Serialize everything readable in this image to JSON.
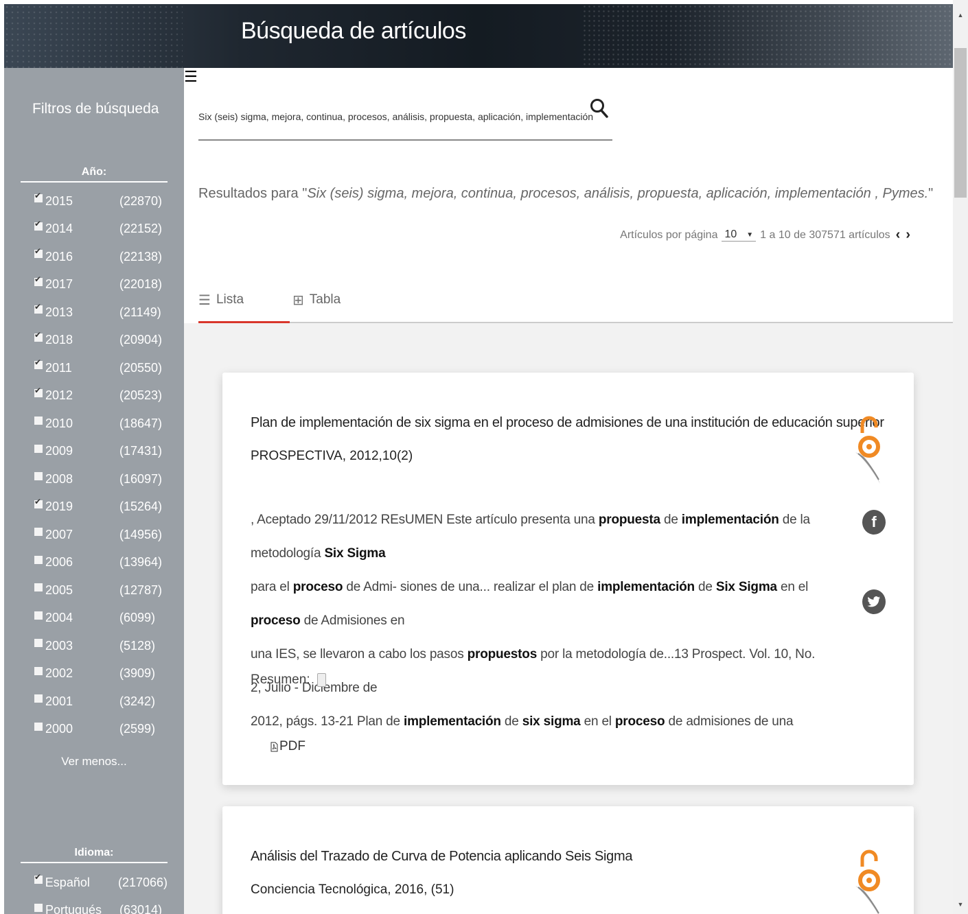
{
  "header": {
    "title": "Búsqueda de artículos"
  },
  "sidebar": {
    "filters_title": "Filtros de búsqueda",
    "year": {
      "title": "Año:",
      "items": [
        {
          "label": "2015",
          "count": "(22870)",
          "checked": true
        },
        {
          "label": "2014",
          "count": "(22152)",
          "checked": true
        },
        {
          "label": "2016",
          "count": "(22138)",
          "checked": true
        },
        {
          "label": "2017",
          "count": "(22018)",
          "checked": true
        },
        {
          "label": "2013",
          "count": "(21149)",
          "checked": true
        },
        {
          "label": "2018",
          "count": "(20904)",
          "checked": true
        },
        {
          "label": "2011",
          "count": "(20550)",
          "checked": true
        },
        {
          "label": "2012",
          "count": "(20523)",
          "checked": true
        },
        {
          "label": "2010",
          "count": "(18647)",
          "checked": false
        },
        {
          "label": "2009",
          "count": "(17431)",
          "checked": false
        },
        {
          "label": "2008",
          "count": "(16097)",
          "checked": false
        },
        {
          "label": "2019",
          "count": "(15264)",
          "checked": true
        },
        {
          "label": "2007",
          "count": "(14956)",
          "checked": false
        },
        {
          "label": "2006",
          "count": "(13964)",
          "checked": false
        },
        {
          "label": "2005",
          "count": "(12787)",
          "checked": false
        },
        {
          "label": "2004",
          "count": "(6099)",
          "checked": false
        },
        {
          "label": "2003",
          "count": "(5128)",
          "checked": false
        },
        {
          "label": "2002",
          "count": "(3909)",
          "checked": false
        },
        {
          "label": "2001",
          "count": "(3242)",
          "checked": false
        },
        {
          "label": "2000",
          "count": "(2599)",
          "checked": false
        }
      ],
      "more_link": "Ver menos..."
    },
    "language": {
      "title": "Idioma:",
      "items": [
        {
          "label": "Español",
          "count": "(217066)",
          "checked": true
        },
        {
          "label": "Portugués",
          "count": "(63014)",
          "checked": false
        }
      ]
    }
  },
  "search": {
    "value": "Six (seis) sigma, mejora, continua, procesos, análisis, propuesta, aplicación, implementación , Pymes.",
    "results_prefix": "Resultados para \"",
    "results_query": "Six (seis) sigma, mejora, continua, procesos, análisis, propuesta, aplicación, implementación , Pymes.",
    "results_suffix": "\""
  },
  "pagination": {
    "per_page_label": "Artículos por página",
    "per_page_value": "10",
    "range_text": "1 a 10 de 307571 artículos"
  },
  "tabs": [
    {
      "label": "Lista",
      "active": true
    },
    {
      "label": "Tabla",
      "active": false
    }
  ],
  "results": [
    {
      "title": "Plan de implementación de six sigma en el proceso de admisiones de una institución de educación superior",
      "source": "PROSPECTIVA, 2012,10(2)",
      "snippet_lines": [
        [
          ", Aceptado 29/11/2012 REsUMEN Este artículo presenta una ",
          {
            "b": "propuesta"
          },
          " de ",
          {
            "b": "implementación"
          },
          " de la metodología ",
          {
            "b": "Six Sigma"
          }
        ],
        [
          "para el ",
          {
            "b": "proceso"
          },
          " de Admi- siones de una... realizar el plan de ",
          {
            "b": "implementación"
          },
          " de ",
          {
            "b": "Six Sigma"
          },
          " en el ",
          {
            "b": "proceso"
          },
          " de Admisiones en"
        ],
        [
          "una IES, se llevaron a cabo los pasos ",
          {
            "b": "propuestos"
          },
          " por la metodología de...13 Prospect. Vol. 10, No. 2, Julio - Diciembre de"
        ],
        [
          "2012, págs. 13-21 Plan de ",
          {
            "b": "implementación"
          },
          " de ",
          {
            "b": "six sigma"
          },
          " en el ",
          {
            "b": "proceso"
          },
          " de admisiones de una"
        ]
      ],
      "resumen_label": "Resumen:",
      "pdf_label": "PDF"
    },
    {
      "title": "Análisis del Trazado de Curva de Potencia aplicando Seis Sigma",
      "source": "Conciencia Tecnológica, 2016, (51)"
    }
  ],
  "icons": {
    "search": "magnifier",
    "open_access": "open-access-lock",
    "facebook": "facebook-f",
    "twitter": "twitter-bird"
  },
  "colors": {
    "accent": "#d9362b",
    "sidebar": "#9aa0a6"
  }
}
